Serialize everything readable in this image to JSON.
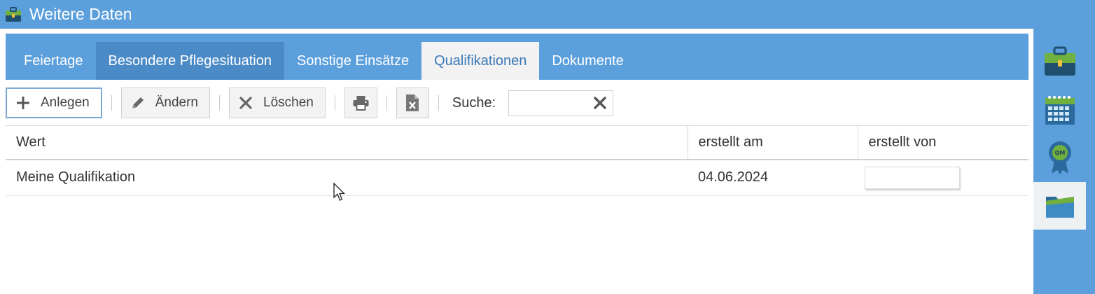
{
  "window": {
    "title": "Weitere Daten"
  },
  "tabs": [
    {
      "label": "Feiertage",
      "state": "normal"
    },
    {
      "label": "Besondere Pflegesituation",
      "state": "hover"
    },
    {
      "label": "Sonstige Einsätze",
      "state": "normal"
    },
    {
      "label": "Qualifikationen",
      "state": "active"
    },
    {
      "label": "Dokumente",
      "state": "normal"
    }
  ],
  "toolbar": {
    "add_label": "Anlegen",
    "edit_label": "Ändern",
    "delete_label": "Löschen",
    "search_label": "Suche:",
    "search_value": ""
  },
  "table": {
    "columns": [
      "Wert",
      "erstellt am",
      "erstellt von"
    ],
    "rows": [
      {
        "wert": "Meine Qualifikation",
        "erstellt_am": "04.06.2024",
        "erstellt_von": ""
      }
    ]
  },
  "sidebar": {
    "items": [
      {
        "icon": "briefcase-icon"
      },
      {
        "icon": "calendar-icon"
      },
      {
        "icon": "qm-badge-icon"
      },
      {
        "icon": "folder-icon",
        "active": true
      }
    ]
  },
  "colors": {
    "accent": "#5b9fdc",
    "tab_active_text": "#3a78b8",
    "tab_hover_bg": "#4a8ac6"
  }
}
